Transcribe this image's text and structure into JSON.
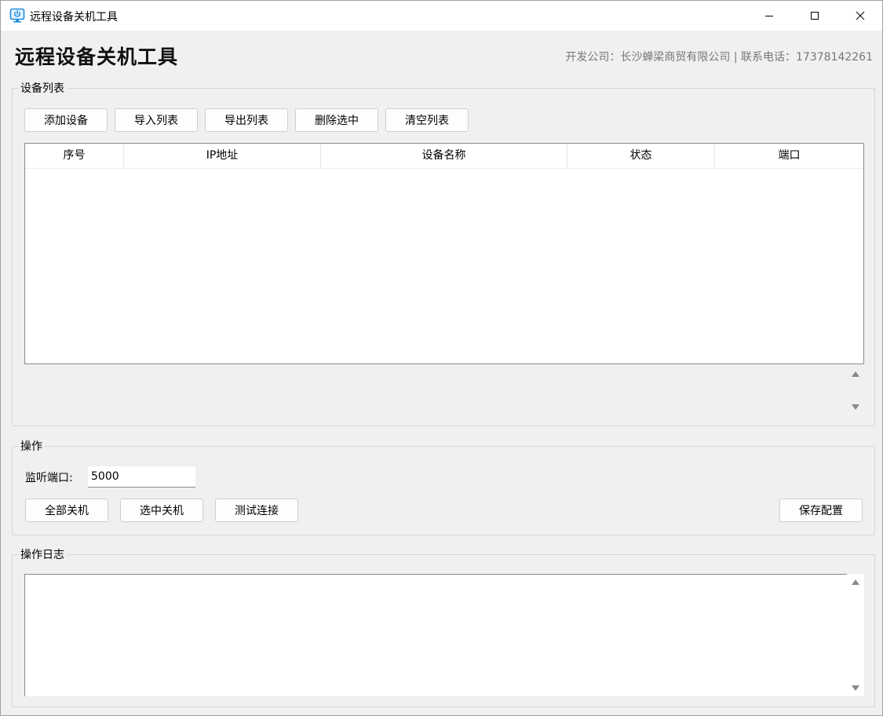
{
  "window": {
    "title": "远程设备关机工具",
    "icon": "monitor-power-icon",
    "controls": [
      "minimize-icon",
      "maximize-icon",
      "close-icon"
    ]
  },
  "header": {
    "title": "远程设备关机工具",
    "company_info": "开发公司：长沙蝉梁商贸有限公司 | 联系电话：17378142261"
  },
  "device_list": {
    "group_title": "设备列表",
    "buttons": {
      "add": "添加设备",
      "import": "导入列表",
      "export": "导出列表",
      "delete": "删除选中",
      "clear": "清空列表"
    },
    "columns": [
      "序号",
      "IP地址",
      "设备名称",
      "状态",
      "端口"
    ],
    "rows": []
  },
  "operations": {
    "group_title": "操作",
    "port_label": "监听端口:",
    "port_value": "5000",
    "buttons": {
      "shutdown_all": "全部关机",
      "shutdown_selected": "选中关机",
      "test_connection": "测试连接",
      "save_config": "保存配置"
    }
  },
  "log": {
    "group_title": "操作日志",
    "content": ""
  },
  "colors": {
    "background": "#f0f0f0",
    "titlebar": "#ffffff",
    "accent": "#0078d4",
    "muted_text": "#777777"
  }
}
